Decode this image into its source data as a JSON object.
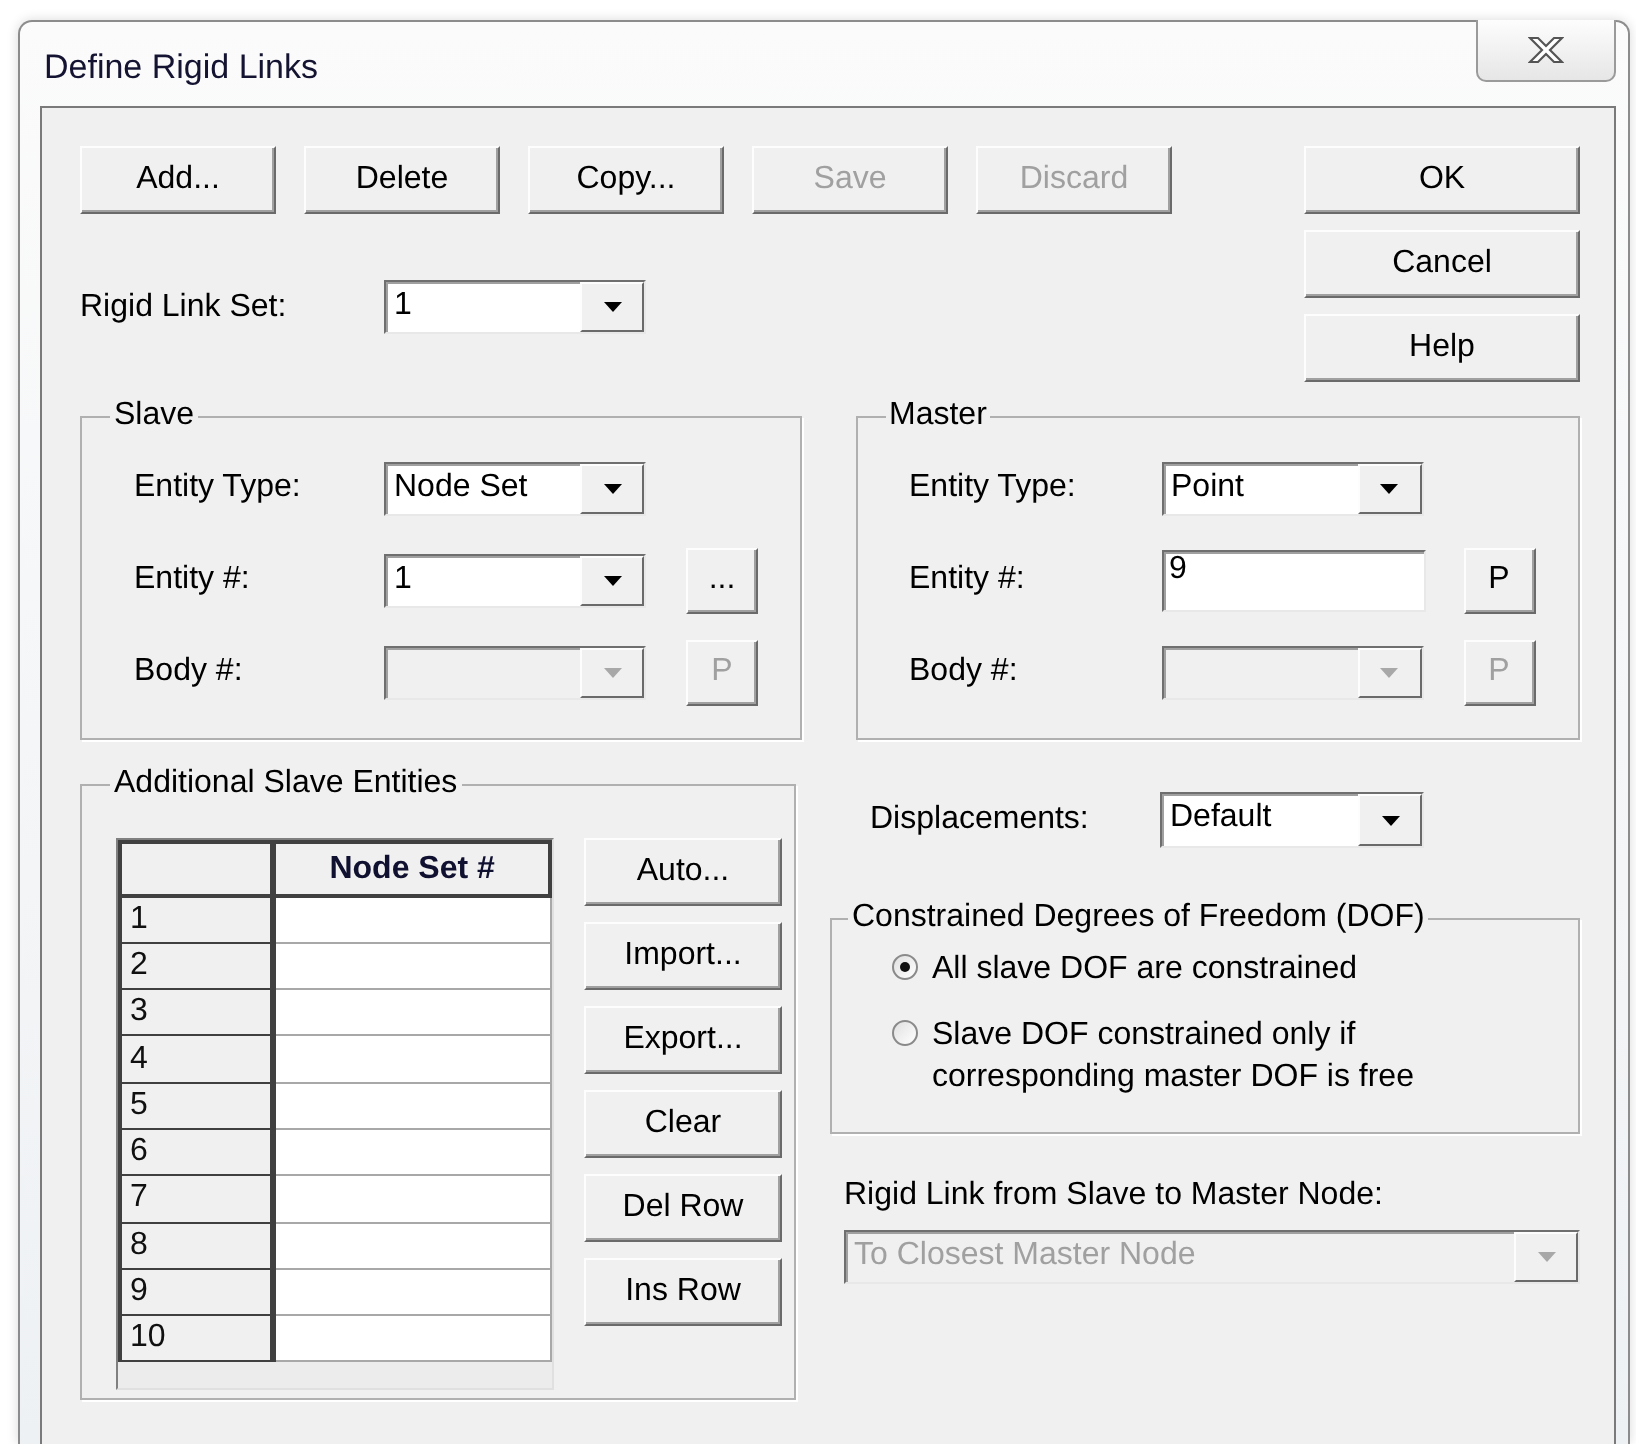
{
  "window": {
    "title": "Define Rigid Links"
  },
  "toolbar_buttons": [
    {
      "label": "Add...",
      "disabled": false
    },
    {
      "label": "Delete",
      "disabled": false
    },
    {
      "label": "Copy...",
      "disabled": false
    },
    {
      "label": "Save",
      "disabled": true
    },
    {
      "label": "Discard",
      "disabled": true
    }
  ],
  "dialog_buttons": [
    {
      "label": "OK"
    },
    {
      "label": "Cancel"
    },
    {
      "label": "Help"
    }
  ],
  "rigid_link_set": {
    "label": "Rigid Link Set:",
    "value": "1"
  },
  "slave": {
    "title": "Slave",
    "fields": [
      {
        "label": "Entity Type:",
        "kind": "combo",
        "value": "Node Set",
        "disabled": false
      },
      {
        "label": "Entity #:",
        "kind": "combo",
        "value": "1",
        "disabled": false,
        "button": {
          "label": "...",
          "disabled": false
        }
      },
      {
        "label": "Body #:",
        "kind": "combo",
        "disabled": true,
        "button": {
          "label": "P",
          "disabled": true
        }
      }
    ]
  },
  "master": {
    "title": "Master",
    "fields": [
      {
        "label": "Entity Type:",
        "kind": "combo",
        "value": "Point",
        "disabled": false
      },
      {
        "label": "Entity #:",
        "kind": "input",
        "value": "9",
        "disabled": false,
        "button": {
          "label": "P",
          "disabled": false
        }
      },
      {
        "label": "Body #:",
        "kind": "combo",
        "disabled": true,
        "button": {
          "label": "P",
          "disabled": true
        }
      }
    ]
  },
  "additional_slave_entities": {
    "title": "Additional Slave Entities",
    "table": {
      "columns": [
        "Node Set #"
      ],
      "rows": [
        "1",
        "2",
        "3",
        "4",
        "5",
        "6",
        "7",
        "8",
        "9",
        "10"
      ]
    },
    "buttons": [
      "Auto...",
      "Import...",
      "Export...",
      "Clear",
      "Del Row",
      "Ins Row"
    ]
  },
  "displacements": {
    "label": "Displacements:",
    "value": "Default"
  },
  "dof": {
    "title": "Constrained Degrees of Freedom (DOF)",
    "options": [
      {
        "label": "All slave DOF are constrained",
        "selected": true
      },
      {
        "label": "Slave DOF constrained only if corresponding master DOF is free",
        "selected": false
      }
    ]
  },
  "rigid_link": {
    "label": "Rigid Link from Slave to Master Node:",
    "value": "To Closest Master Node",
    "disabled": true
  }
}
